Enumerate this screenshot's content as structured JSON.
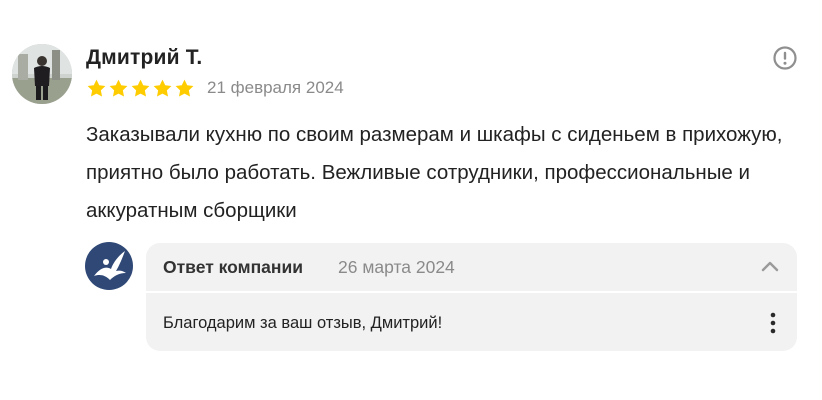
{
  "review": {
    "author": {
      "name": "Дмитрий Т.",
      "avatar_icon": "user-photo"
    },
    "rating": {
      "value": 5,
      "max": 5,
      "star_color": "#FFCC00"
    },
    "date": "21 февраля 2024",
    "text": "Заказывали кухню по своим размерам и шкафы с сиденьем в прихожую, приятно было работать. Вежливые сотрудники, профессиональные и аккуратным сборщики",
    "report_icon": "exclamation-circle-icon"
  },
  "company_reply": {
    "logo_icon": "bird-logo",
    "logo_color": "#2F4876",
    "title": "Ответ компании",
    "date": "26 марта 2024",
    "text": "Благодарим за ваш отзыв, Дмитрий!",
    "collapse_icon": "chevron-up-icon",
    "menu_icon": "more-vertical-icon"
  }
}
